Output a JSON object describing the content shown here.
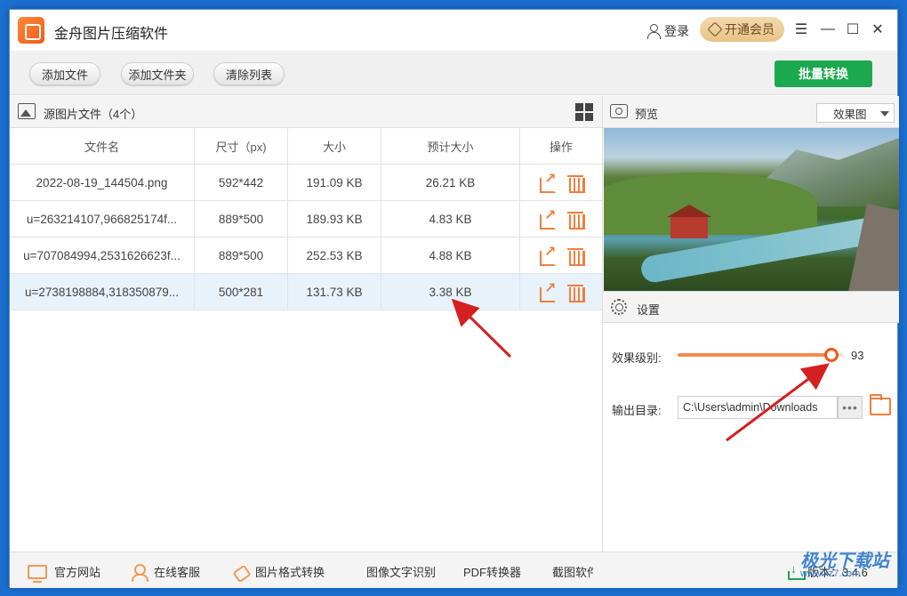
{
  "app": {
    "title": "金舟图片压缩软件"
  },
  "titlebar": {
    "login": "登录",
    "vip": "开通会员"
  },
  "toolbar": {
    "add_file": "添加文件",
    "add_folder": "添加文件夹",
    "clear_list": "清除列表",
    "batch_convert": "批量转换"
  },
  "left_panel": {
    "title": "源图片文件（4个）",
    "columns": [
      "文件名",
      "尺寸（px)",
      "大小",
      "预计大小",
      "操作"
    ],
    "rows": [
      {
        "name": "2022-08-19_144504.png",
        "dims": "592*442",
        "size": "191.09 KB",
        "est": "26.21 KB"
      },
      {
        "name": "u=263214107,966825174f...",
        "dims": "889*500",
        "size": "189.93 KB",
        "est": "4.83 KB"
      },
      {
        "name": "u=707084994,2531626623f...",
        "dims": "889*500",
        "size": "252.53 KB",
        "est": "4.88 KB"
      },
      {
        "name": "u=2738198884,318350879...",
        "dims": "500*281",
        "size": "131.73 KB",
        "est": "3.38 KB"
      }
    ]
  },
  "right_panel": {
    "preview_title": "预览",
    "preview_mode": "效果图",
    "settings_title": "设置",
    "quality_label": "效果级别:",
    "quality_value": "93",
    "quality_fraction": 0.93,
    "output_label": "输出目录:",
    "output_path": "C:\\Users\\admin\\Downloads",
    "browse_dots": "•••"
  },
  "footer": {
    "website": "官方网站",
    "support": "在线客服",
    "format_convert": "图片格式转换",
    "ocr": "图像文字识别",
    "pdf": "PDF转换器",
    "screenshot": "截图软件",
    "version": "版本：3.4.6"
  },
  "watermark": {
    "text": "极光下载站",
    "url": "www.xz7.com"
  },
  "colors": {
    "accent": "#f05a14",
    "green": "#1ca84e",
    "arrow": "#d42020"
  }
}
